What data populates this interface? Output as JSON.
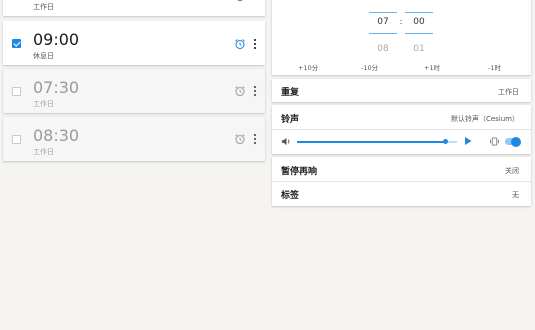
{
  "alarms": [
    {
      "time": "",
      "label": "工作日",
      "enabled": true
    },
    {
      "time": "09:00",
      "label": "休息日",
      "enabled": true
    },
    {
      "time": "07:30",
      "label": "工作日",
      "enabled": false
    },
    {
      "time": "08:30",
      "label": "工作日",
      "enabled": false
    }
  ],
  "picker": {
    "hour": "07",
    "minute": "00",
    "separator": ":",
    "next_hour": "08",
    "next_minute": "01",
    "adjust": [
      "+10分",
      "-10分",
      "+1时",
      "-1时"
    ]
  },
  "settings": {
    "repeat_label": "重复",
    "repeat_value": "工作日",
    "ringtone_label": "铃声",
    "ringtone_value": "默认铃声（Cesium）",
    "volume_fraction": 0.93,
    "vibrate_on": true,
    "snooze_label": "暂停再响",
    "snooze_value": "关闭",
    "tag_label": "标签",
    "tag_value": "无"
  },
  "colors": {
    "accent": "#1e88e5"
  }
}
